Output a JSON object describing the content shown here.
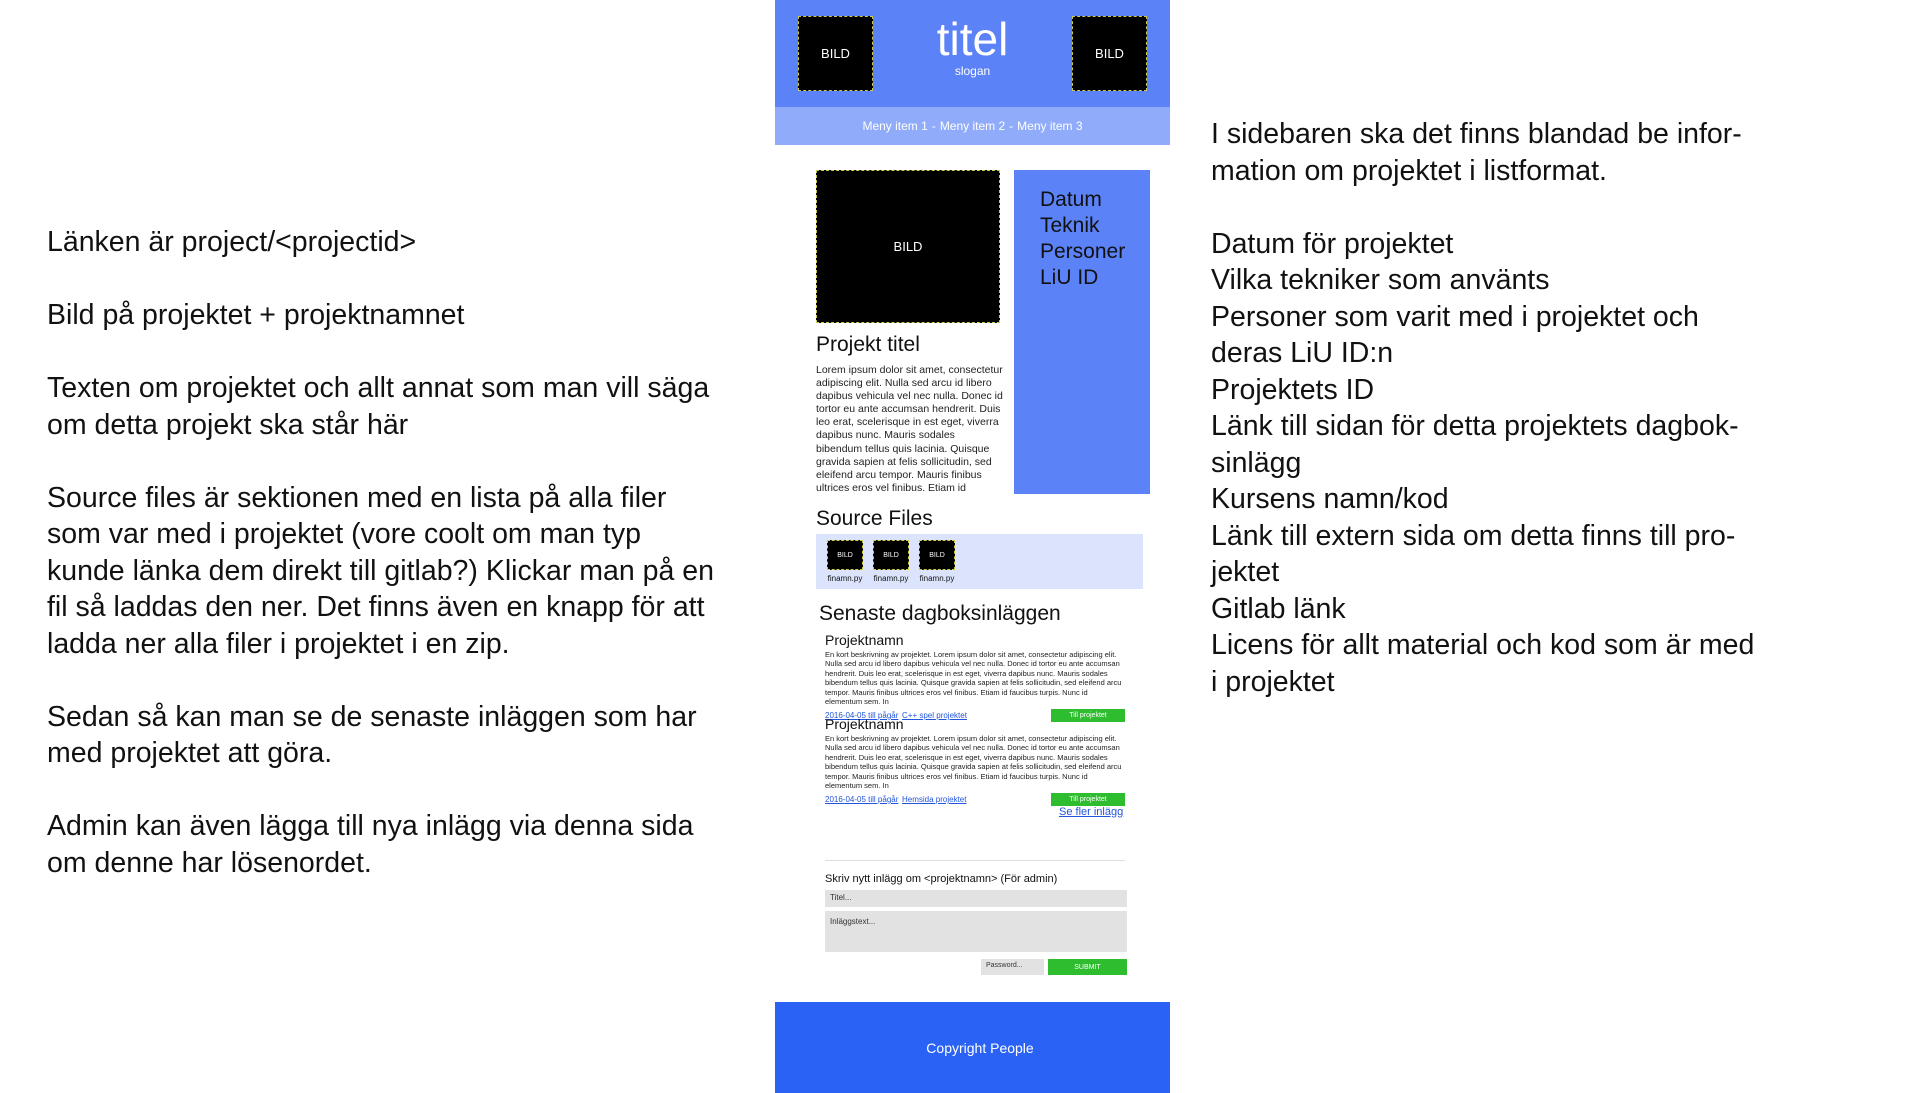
{
  "left_notes": {
    "line1": "Länken är project/<projectid>",
    "line2": "Bild på projektet + projektnamnet",
    "line3": "Texten om projektet och allt annat som man vill säga",
    "line4": "om detta projekt ska står här",
    "line5": "Source files är sektionen med en lista på alla filer",
    "line6": "som var med i projektet (vore coolt om man typ",
    "line7": "kunde länka dem direkt till gitlab?) Klickar man på en",
    "line8": "fil så laddas den ner. Det finns även en knapp för att",
    "line9": "ladda ner alla filer i projektet i en zip.",
    "line10": "Sedan så kan man se de senaste inläggen som har",
    "line11": "med projektet att göra.",
    "line12": "Admin kan även lägga till nya inlägg via denna sida",
    "line13": "om denne har lösenordet."
  },
  "right_notes": {
    "line1": "I sidebaren ska det finns blandad be infor-",
    "line2": "mation om projektet i listformat.",
    "line3": "Datum för projektet",
    "line4": "Vilka tekniker som använts",
    "line5": "Personer som varit med i projektet och",
    "line6": "deras LiU ID:n",
    "line7": "Projektets ID",
    "line8": "Länk till sidan för detta projektets dagbok-",
    "line9": "sinlägg",
    "line10": "Kursens namn/kod",
    "line11": "Länk till extern sida om detta finns till pro-",
    "line12": "jektet",
    "line13": "Gitlab länk",
    "line14": "Licens för allt material och kod som är med",
    "line15": "i projektet"
  },
  "mockup": {
    "header": {
      "image_left": "BILD",
      "image_right": "BILD",
      "title": "titel",
      "slogan": "slogan"
    },
    "menu": {
      "item1": "Meny item 1",
      "item2": "Meny item 2",
      "item3": "Meny item 3",
      "separator": "-"
    },
    "project": {
      "image": "BILD",
      "title": "Projekt titel",
      "text": "Lorem ipsum dolor sit amet, consectetur adipiscing elit. Nulla sed arcu id libero dapibus vehicula vel nec nulla. Donec id tortor eu ante accumsan hendrerit. Duis leo erat, scelerisque in est eget, viverra dapibus nunc. Mauris sodales bibendum tellus quis lacinia. Quisque gravida sapien at felis sollicitudin, sed eleifend arcu tempor. Mauris finibus ultrices eros vel finibus. Etiam id"
    },
    "sidebar": {
      "items": [
        "Datum",
        "Teknik",
        "Personer",
        "LiU ID"
      ]
    },
    "source_files": {
      "heading": "Source Files",
      "files": [
        {
          "thumb": "BILD",
          "name": "finamn.py"
        },
        {
          "thumb": "BILD",
          "name": "finamn.py"
        },
        {
          "thumb": "BILD",
          "name": "finamn.py"
        }
      ]
    },
    "diary": {
      "heading": "Senaste dagboksinläggen",
      "entries": [
        {
          "name": "Projektnamn",
          "text": "En kort beskrivning av projektet. Lorem ipsum dolor sit amet, consectetur adipiscing elit. Nulla sed arcu id libero dapibus vehicula vel nec nulla. Donec id tortor eu ante accumsan hendrerit. Duis leo erat, scelerisque in est eget, viverra dapibus nunc. Mauris sodales bibendum tellus quis lacinia. Quisque gravida sapien at felis sollicitudin, sed eleifend arcu tempor. Mauris finibus ultrices eros vel finibus. Etiam id faucibus turpis. Nunc id elementum sem. In",
          "date": "2016-04-05 till pågår",
          "link": "C++ spel projektet",
          "button": "Till projektet"
        },
        {
          "name": "Projektnamn",
          "text": "En kort beskrivning av projektet. Lorem ipsum dolor sit amet, consectetur adipiscing elit. Nulla sed arcu id libero dapibus vehicula vel nec nulla. Donec id tortor eu ante accumsan hendrerit. Duis leo erat, scelerisque in est eget, viverra dapibus nunc. Mauris sodales bibendum tellus quis lacinia. Quisque gravida sapien at felis sollicitudin, sed eleifend arcu tempor. Mauris finibus ultrices eros vel finibus. Etiam id faucibus turpis. Nunc id elementum sem. In",
          "date": "2016-04-05 till pågår",
          "link": "Hemsida projektet",
          "button": "Till projektet"
        }
      ],
      "more_link": "Se fler inlägg"
    },
    "form": {
      "title": "Skriv nytt inlägg om <projektnamn> (För admin)",
      "title_placeholder": "Titel...",
      "text_placeholder": "Inläggstext...",
      "password_placeholder": "Password...",
      "submit": "SUBMIT"
    },
    "footer": "Copyright People"
  }
}
